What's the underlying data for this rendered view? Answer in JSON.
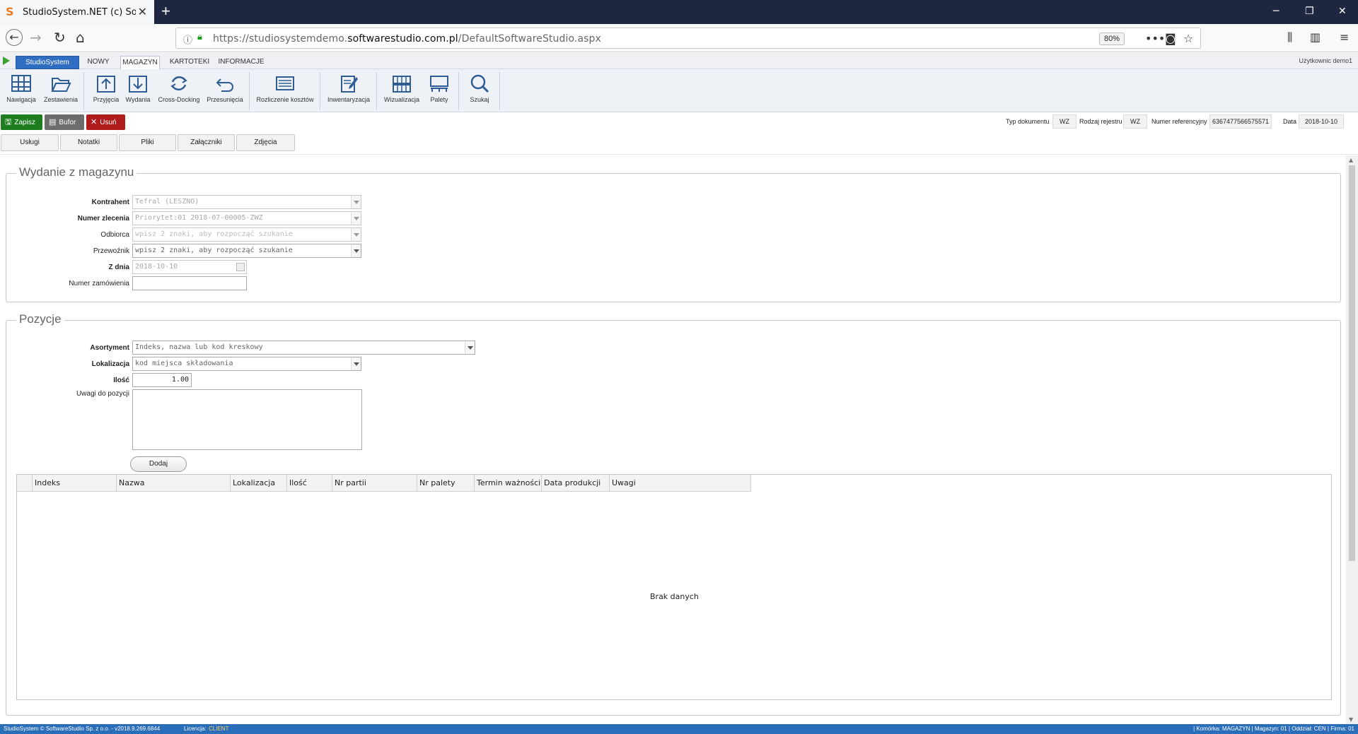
{
  "browser": {
    "tab_title": "StudioSystem.NET (c) Software",
    "url_prefix": "https://studiosystemdemo.",
    "url_domain": "softwarestudio.com.pl",
    "url_path": "/DefaultSoftwareStudio.aspx",
    "zoom": "80%"
  },
  "menu": {
    "tabs": [
      "StudioSystem",
      "NOWY",
      "MAGAZYN",
      "KARTOTEKI",
      "INFORMACJE"
    ],
    "active_tab": "MAGAZYN",
    "user": "Użytkownic demo1"
  },
  "ribbon": {
    "buttons": [
      "Nawigacja",
      "Zestawienia",
      "Przyjęcia",
      "Wydania",
      "Cross-Docking",
      "Przesunięcia",
      "Rozliczenie kosztów",
      "Inwentaryzacja",
      "Wizualizacja",
      "Palety",
      "Szukaj"
    ]
  },
  "actions": {
    "save": "Zapisz",
    "buffer": "Bufor",
    "delete": "Usuń",
    "colors": {
      "save": "#1e7d1e",
      "buffer": "#6d6d6d",
      "delete": "#b01c1c"
    }
  },
  "doc": {
    "type_label": "Typ dokumentu",
    "type_value": "WZ",
    "register_label": "Rodzaj rejestru",
    "register_value": "WZ",
    "ref_label": "Numer referencyjny",
    "ref_value": "636747756657557​1",
    "date_label": "Data",
    "date_value": "2018-10-10"
  },
  "subtabs": [
    "Usługi",
    "Notatki",
    "Pliki",
    "Załączniki",
    "Zdjęcia"
  ],
  "header_panel": {
    "title": "Wydanie z magazynu",
    "fields": {
      "kontrahent_label": "Kontrahent",
      "kontrahent_value": "Tefral (LESZNO)",
      "zlecenie_label": "Numer zlecenia",
      "zlecenie_value": "Priorytet:01 2018-07-00005-ZWZ",
      "odbiorca_label": "Odbiorca",
      "odbiorca_placeholder": "wpisz 2 znaki, aby rozpocząć szukanie",
      "przewoznik_label": "Przewoźnik",
      "przewoznik_placeholder": "wpisz 2 znaki, aby rozpocząć szukanie",
      "zdnia_label": "Z dnia",
      "zdnia_value": "2018-10-10",
      "zamowienie_label": "Numer zamówienia",
      "zamowienie_value": ""
    }
  },
  "positions_panel": {
    "title": "Pozycje",
    "asortyment_label": "Asortyment",
    "asortyment_placeholder": "Indeks, nazwa lub kod kreskowy",
    "lokalizacja_label": "Lokalizacja",
    "lokalizacja_placeholder": "kod miejsca składowania",
    "ilosc_label": "Ilość",
    "ilosc_value": "1.00",
    "uwagi_label": "Uwagi do pozycji",
    "add_button": "Dodaj",
    "grid_columns": [
      "",
      "Indeks",
      "Nazwa",
      "Lokalizacja",
      "Ilość",
      "Nr partii",
      "Nr palety",
      "Termin ważności",
      "Data produkcji",
      "Uwagi"
    ],
    "empty_text": "Brak danych"
  },
  "status": {
    "left": "StudioSystem © SoftwareStudio Sp. z o.o. - v2018.9.269.6844",
    "license_label": "Licencja:",
    "license_value": "CLIENT",
    "right": "| Komórka: MAGAZYN | Magazyn: 01 | Oddział: CEN | Firma: 01"
  }
}
